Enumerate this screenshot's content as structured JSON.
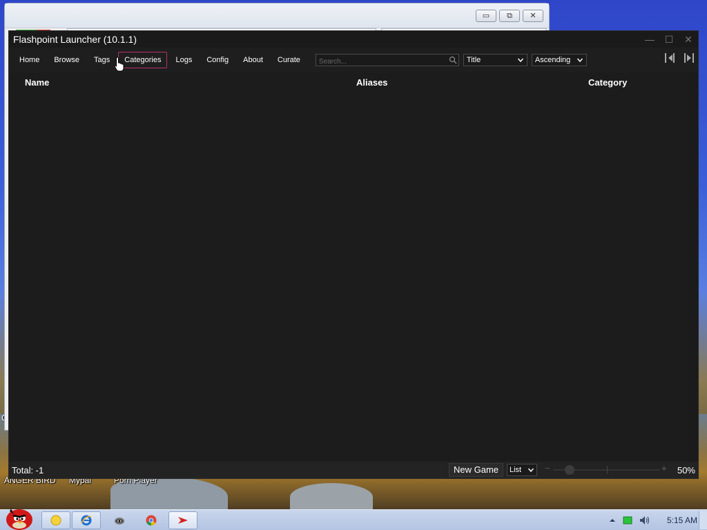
{
  "window": {
    "title": "Flashpoint Launcher (10.1.1)",
    "minimize": "—",
    "maximize": "☐",
    "close": "✕"
  },
  "nav": {
    "items": [
      {
        "label": "Home"
      },
      {
        "label": "Browse"
      },
      {
        "label": "Tags"
      },
      {
        "label": "Categories",
        "active": true
      },
      {
        "label": "Logs"
      },
      {
        "label": "Config"
      },
      {
        "label": "About"
      },
      {
        "label": "Curate"
      }
    ]
  },
  "search": {
    "placeholder": "Search..."
  },
  "sort": {
    "field": "Title",
    "order": "Ascending"
  },
  "columns": {
    "name": "Name",
    "aliases": "Aliases",
    "category": "Category"
  },
  "status": {
    "total": "Total: -1",
    "new_game": "New Game",
    "view": "List",
    "zoom_minus": "−",
    "zoom_plus": "+",
    "zoom_value": "50%",
    "zoom_fraction": 0.12
  },
  "desktop": {
    "icons": [
      "ANGER BIRD",
      "Mypal",
      "Porn Player"
    ],
    "fragment": "C"
  },
  "taskbar": {
    "clock": "5:15 AM"
  },
  "colors": {
    "accent": "#b5346c",
    "app_bg": "#1e1e1e"
  }
}
